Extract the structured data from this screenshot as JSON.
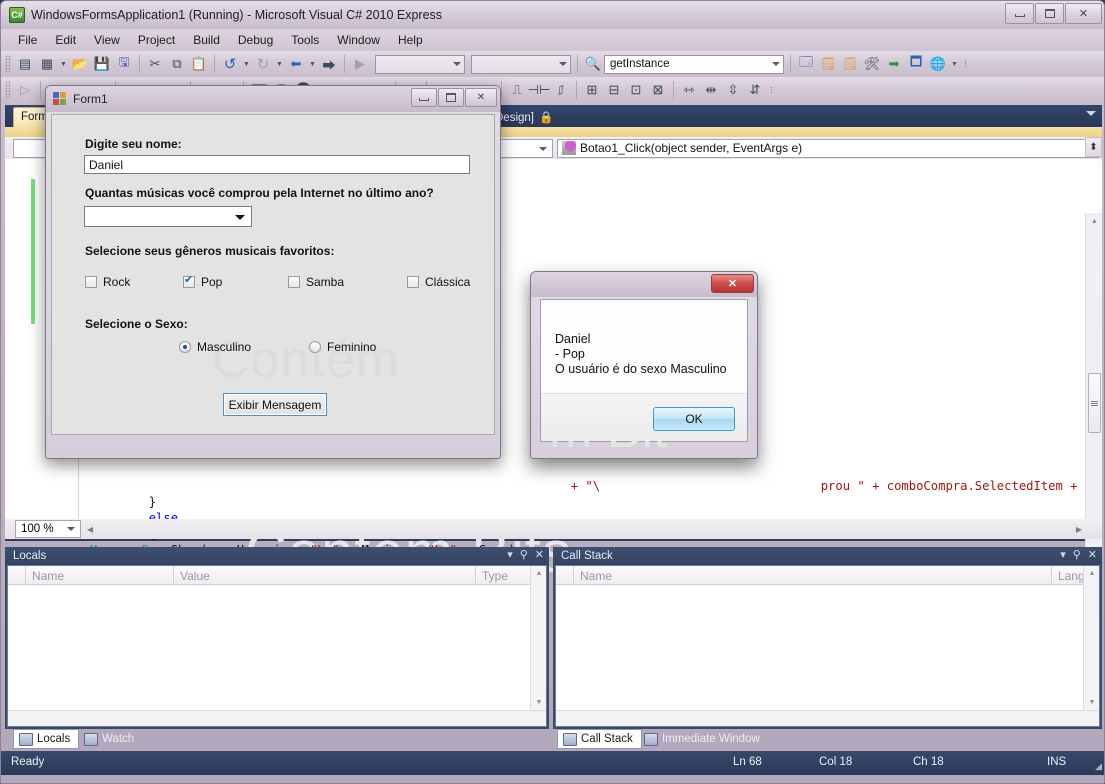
{
  "window": {
    "title": "WindowsFormsApplication1 (Running) - Microsoft Visual C# 2010 Express",
    "icon": "csharp-icon",
    "minimize": "—",
    "maximize": "□",
    "close": "✕"
  },
  "menu": {
    "items": [
      "File",
      "Edit",
      "View",
      "Project",
      "Build",
      "Debug",
      "Tools",
      "Window",
      "Help"
    ]
  },
  "toolbar": {
    "combo_empty_value": "",
    "search_value": "getInstance",
    "icons": [
      "new-item-icon",
      "add-item-icon",
      "open-file-icon",
      "save-icon",
      "save-all-icon",
      "cut-icon",
      "copy-icon",
      "paste-icon",
      "undo-icon",
      "redo-icon",
      "comment-icon",
      "uncomment-icon",
      "start-debug-icon"
    ]
  },
  "editor": {
    "tab_label": "Form1",
    "tab_title_rest": "Design]",
    "lock_glyph": "🔒",
    "nav_left_value": "",
    "nav_right_value": "Botao1_Click(object sender, EventArgs e)",
    "zoom_level": "100 %",
    "code_lines": [
      "        }",
      "        else",
      "        {",
      "            MessageBox.Show(nomeUsuario + \"\\n\" + Musica + \"\\n\" + Sexo);"
    ],
    "partial_line_right": "prou \" + comboCompra.SelectedItem + \"",
    "partial_line_left": "+ \"\\",
    "watermark": "Contém Bits"
  },
  "locals_pane": {
    "title": "Locals",
    "columns": [
      "Name",
      "Value",
      "Type"
    ],
    "rows": []
  },
  "callstack_pane": {
    "title": "Call Stack",
    "columns": [
      "Name",
      "Lang"
    ],
    "rows": []
  },
  "tool_tabs": {
    "left": [
      {
        "label": "Locals",
        "icon": "locals-icon",
        "active": true
      },
      {
        "label": "Watch",
        "icon": "watch-icon",
        "active": false
      }
    ],
    "right": [
      {
        "label": "Call Stack",
        "icon": "callstack-icon",
        "active": true
      },
      {
        "label": "Immediate Window",
        "icon": "immediate-window-icon",
        "active": false
      }
    ]
  },
  "status_bar": {
    "state": "Ready",
    "line": "Ln 68",
    "col": "Col 18",
    "ch": "Ch 18",
    "ins": "INS"
  },
  "form1": {
    "title": "Form1",
    "icon": "winform-icon",
    "minimize": "—",
    "maximize": "□",
    "close": "✕",
    "name_label": "Digite seu nome:",
    "name_value": "Daniel",
    "purchase_label": "Quantas músicas você comprou pela Internet no último ano?",
    "purchase_value": "",
    "genres_label": "Selecione seus gêneros musicais favoritos:",
    "genres": [
      {
        "label": "Rock",
        "checked": false
      },
      {
        "label": "Pop",
        "checked": true
      },
      {
        "label": "Samba",
        "checked": false
      },
      {
        "label": "Clássica",
        "checked": false
      }
    ],
    "sex_label": "Selecione o Sexo:",
    "sexes": [
      {
        "label": "Masculino",
        "selected": true
      },
      {
        "label": "Feminino",
        "selected": false
      }
    ],
    "submit_label": "Exibir Mensagem",
    "watermark": "Contém"
  },
  "message_box": {
    "close": "✕",
    "line1": "Daniel",
    "line2": "- Pop",
    "line3": "O usuário é do sexo Masculino",
    "ok_label": "OK",
    "watermark": "m Bit"
  },
  "colors": {
    "chrome": "#d0c6d4",
    "panel_blue": "#3a4a69",
    "tab_yellow": "#f6e5b4",
    "accent_blue": "#3c9bd4",
    "close_red": "#cf4d4d",
    "breakpoint_green": "#72e07a",
    "keyword_blue": "#0000ff",
    "string_red": "#a31515",
    "type_teal": "#2b91af"
  }
}
